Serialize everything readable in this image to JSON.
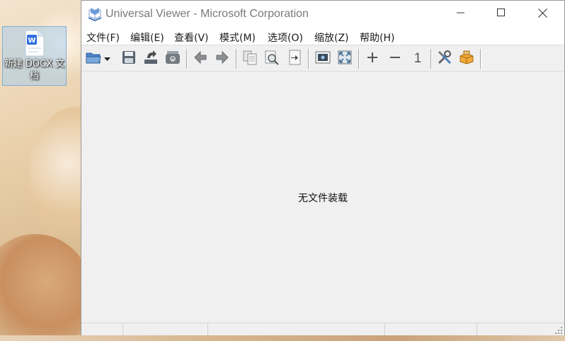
{
  "desktop": {
    "icon_label": "新建 DOCX 文档",
    "icon_name": "wps-word-document-icon",
    "accent_color": "#2f6fe0"
  },
  "window": {
    "title": "Universal Viewer - Microsoft Corporation",
    "controls": {
      "minimize": "minimize-icon",
      "maximize": "maximize-icon",
      "close": "close-icon"
    }
  },
  "menu": {
    "items": [
      "文件(F)",
      "编辑(E)",
      "查看(V)",
      "模式(M)",
      "选项(O)",
      "缩放(Z)",
      "帮助(H)"
    ]
  },
  "toolbar": {
    "zoom_actual_label": "1",
    "buttons": [
      "open-folder-icon",
      "dropdown-arrow-icon",
      "save-icon",
      "reload-icon",
      "print-icon",
      "back-arrow-icon",
      "forward-arrow-icon",
      "copy-icon",
      "find-icon",
      "goto-icon",
      "window-mode-icon",
      "fullscreen-icon",
      "zoom-in-icon",
      "zoom-out-icon",
      "zoom-actual-icon",
      "settings-tools-icon",
      "plugins-icon"
    ]
  },
  "content": {
    "empty_message": "无文件装载"
  }
}
